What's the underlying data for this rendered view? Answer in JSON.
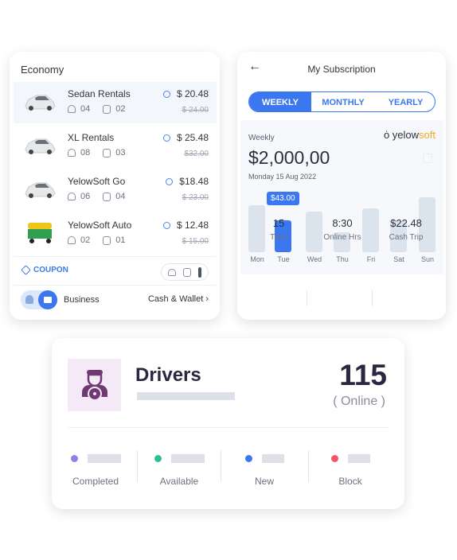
{
  "economy": {
    "title": "Economy",
    "rides": [
      {
        "name": "Sedan Rentals",
        "seats": "04",
        "bags": "02",
        "price": "$ 20.48",
        "old_price": "$ 24.00",
        "vehicle": "sedan",
        "selected": true
      },
      {
        "name": "XL Rentals",
        "seats": "08",
        "bags": "03",
        "price": "$ 25.48",
        "old_price": "$32.00",
        "vehicle": "minivan",
        "selected": false
      },
      {
        "name": "YelowSoft Go",
        "seats": "06",
        "bags": "04",
        "price": "$18.48",
        "old_price": "$ 23.00",
        "vehicle": "sedan",
        "selected": false
      },
      {
        "name": "YelowSoft Auto",
        "seats": "02",
        "bags": "01",
        "price": "$ 12.48",
        "old_price": "$ 15.00",
        "vehicle": "auto-rickshaw",
        "selected": false
      }
    ],
    "coupon": "COUPON",
    "mode": "Business",
    "payment": "Cash & Wallet",
    "accent": "#3b78f0"
  },
  "subscription": {
    "title": "My Subscription",
    "tabs": [
      "WEEKLY",
      "MONTHLY",
      "YEARLY"
    ],
    "active_tab": "WEEKLY",
    "period_label": "Weekly",
    "brand": {
      "prefix": "yelow",
      "suffix": "soft"
    },
    "amount": "$2,000,00",
    "date": "Monday 15 Aug 2022",
    "chart": {
      "days": [
        "Mon",
        "Tue",
        "Wed",
        "Thu",
        "Fri",
        "Sat",
        "Sun"
      ],
      "levels": [
        0.86,
        0.58,
        0.74,
        0.36,
        0.8,
        0.57,
        1.0
      ],
      "highlight_index": 1,
      "tooltip": "$43.00"
    },
    "stats": [
      {
        "value": "15",
        "label": "Trips"
      },
      {
        "value": "8:30",
        "label": "Online Hrs"
      },
      {
        "value": "$22.48",
        "label": "Cash Trip"
      }
    ]
  },
  "drivers": {
    "title": "Drivers",
    "count": "115",
    "count_label": "( Online )",
    "statuses": [
      {
        "label": "Completed",
        "color": "#8b84e8"
      },
      {
        "label": "Available",
        "color": "#2bbf98"
      },
      {
        "label": "New",
        "color": "#3b78f0"
      },
      {
        "label": "Block",
        "color": "#f2556a"
      }
    ]
  }
}
